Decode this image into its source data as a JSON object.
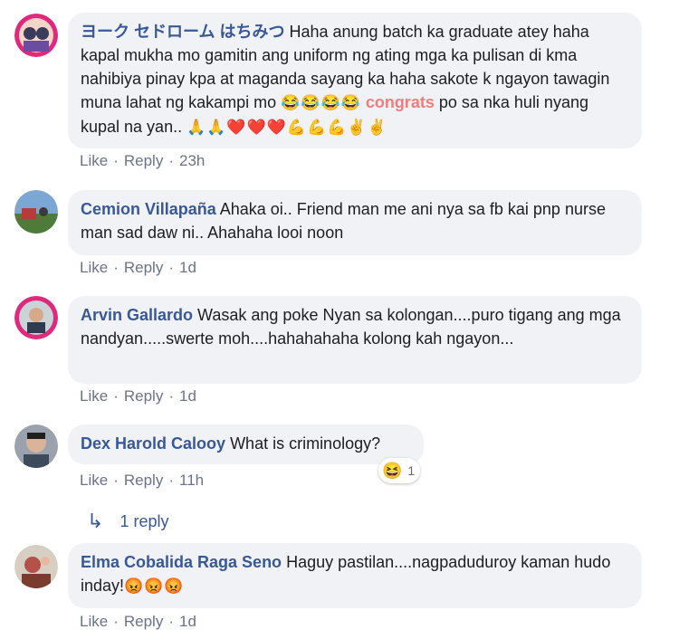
{
  "comments": [
    {
      "author": "ヨーク セドローム はちみつ",
      "text": "Haha anung batch ka graduate atey haha kapal mukha mo gamitin ang uniform ng ating mga ka pulisan di kma nahibiya pinay kpa at maganda sayang ka haha sakote k ngayon tawagin muna lahat ng kakampi mo ",
      "emoji_a": "😂😂😂😂",
      "highlight": "congrats",
      "text2": "po sa nka huli nyang kupal na yan.. ",
      "emoji_b": "🙏🙏❤️❤️❤️💪💪💪✌️✌️",
      "like": "Like",
      "reply": "Reply",
      "time": "23h"
    },
    {
      "author": "Cemion Villapaña",
      "text": "Ahaka oi.. Friend man me ani nya sa fb kai pnp nurse man sad daw ni.. Ahahaha looi noon",
      "like": "Like",
      "reply": "Reply",
      "time": "1d"
    },
    {
      "author": "Arvin Gallardo",
      "text": "Wasak ang poke Nyan sa kolongan....puro tigang ang mga nandyan.....swerte moh....hahahahaha kolong kah ngayon...",
      "like": "Like",
      "reply": "Reply",
      "time": "1d"
    },
    {
      "author": "Dex Harold Calooy",
      "text": "What is criminology?",
      "like": "Like",
      "reply": "Reply",
      "time": "11h",
      "reaction_icon": "😆",
      "reaction_count": "1",
      "replies_link": "1 reply"
    },
    {
      "author": "Elma Cobalida Raga Seno",
      "text": "Haguy pastilan....nagpaduduroy kaman hudo inday!",
      "emoji": "😡😡😡",
      "like": "Like",
      "reply": "Reply",
      "time": "1d"
    }
  ],
  "icons": {
    "reply_arrow": "reply-arrow-icon",
    "reaction": "haha-reaction-icon"
  },
  "colors": {
    "author": "#385898",
    "bubble": "#f0f2f5",
    "meta": "#6a7388",
    "highlight": "#f07c7c"
  }
}
